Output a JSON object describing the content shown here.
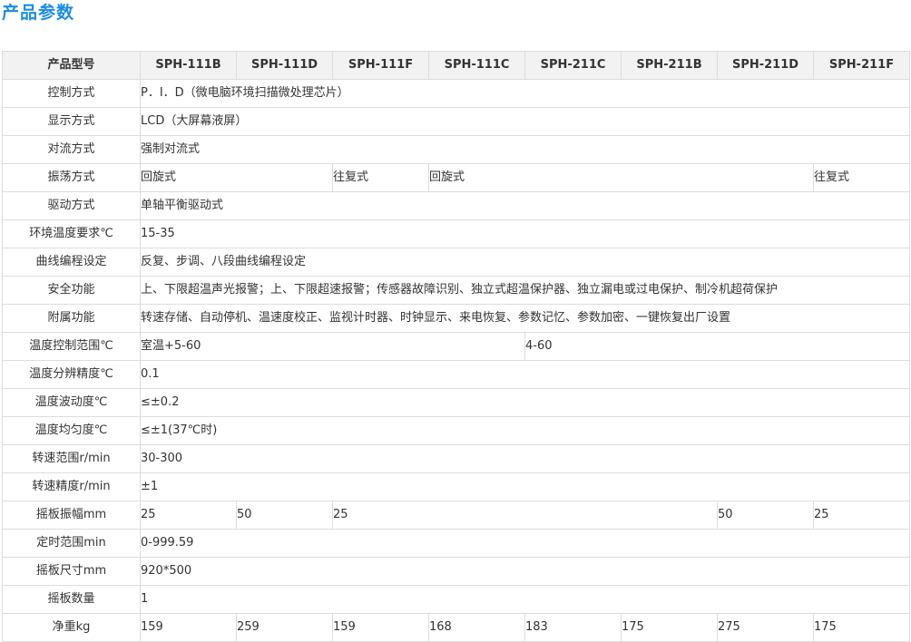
{
  "title": "产品参数",
  "header": [
    "产品型号",
    "SPH-111B",
    "SPH-111D",
    "SPH-111F",
    "SPH-111C",
    "SPH-211C",
    "SPH-211B",
    "SPH-211D",
    "SPH-211F"
  ],
  "rows": [
    {
      "label": "控制方式",
      "cells": [
        {
          "text": "P．I．D（微电脑环境扫描微处理芯片）",
          "span": 8
        }
      ]
    },
    {
      "label": "显示方式",
      "cells": [
        {
          "text": "LCD（大屏幕液屏）",
          "span": 8
        }
      ]
    },
    {
      "label": "对流方式",
      "cells": [
        {
          "text": "强制对流式",
          "span": 8
        }
      ]
    },
    {
      "label": "振荡方式",
      "cells": [
        {
          "text": "回旋式",
          "span": 2
        },
        {
          "text": "往复式",
          "span": 1
        },
        {
          "text": "回旋式",
          "span": 4
        },
        {
          "text": "往复式",
          "span": 1
        }
      ]
    },
    {
      "label": "驱动方式",
      "cells": [
        {
          "text": "单轴平衡驱动式",
          "span": 8
        }
      ]
    },
    {
      "label": "环境温度要求℃",
      "cells": [
        {
          "text": "15-35",
          "span": 8
        }
      ]
    },
    {
      "label": "曲线编程设定",
      "cells": [
        {
          "text": "反复、步调、八段曲线编程设定",
          "span": 8
        }
      ]
    },
    {
      "label": "安全功能",
      "cells": [
        {
          "text": "上、下限超温声光报警；上、下限超速报警；传感器故障识别、独立式超温保护器、独立漏电或过电保护、制冷机超荷保护",
          "span": 8
        }
      ]
    },
    {
      "label": "附属功能",
      "cells": [
        {
          "text": "转速存储、自动停机、温速度校正、监视计时器、时钟显示、来电恢复、参数记忆、参数加密、一键恢复出厂设置",
          "span": 8
        }
      ]
    },
    {
      "label": "温度控制范围℃",
      "cells": [
        {
          "text": "室温+5-60",
          "span": 4
        },
        {
          "text": "4-60",
          "span": 4
        }
      ]
    },
    {
      "label": "温度分辨精度℃",
      "cells": [
        {
          "text": "0.1",
          "span": 8
        }
      ]
    },
    {
      "label": "温度波动度℃",
      "cells": [
        {
          "text": "≤±0.2",
          "span": 8
        }
      ]
    },
    {
      "label": "温度均匀度℃",
      "cells": [
        {
          "text": "≤±1(37℃时)",
          "span": 8
        }
      ]
    },
    {
      "label": "转速范围r/min",
      "cells": [
        {
          "text": "30-300",
          "span": 8
        }
      ]
    },
    {
      "label": "转速精度r/min",
      "cells": [
        {
          "text": "±1",
          "span": 8
        }
      ]
    },
    {
      "label": "摇板振幅mm",
      "cells": [
        {
          "text": "25",
          "span": 1
        },
        {
          "text": "50",
          "span": 1
        },
        {
          "text": "25",
          "span": 4
        },
        {
          "text": "50",
          "span": 1
        },
        {
          "text": "25",
          "span": 1
        }
      ]
    },
    {
      "label": "定时范围min",
      "cells": [
        {
          "text": "0-999.59",
          "span": 8
        }
      ]
    },
    {
      "label": "摇板尺寸mm",
      "cells": [
        {
          "text": "920*500",
          "span": 8
        }
      ]
    },
    {
      "label": "摇板数量",
      "cells": [
        {
          "text": "1",
          "span": 8
        }
      ]
    },
    {
      "label": "净重kg",
      "cells": [
        {
          "text": "159",
          "span": 1
        },
        {
          "text": "259",
          "span": 1
        },
        {
          "text": "159",
          "span": 1
        },
        {
          "text": "168",
          "span": 1
        },
        {
          "text": "183",
          "span": 1
        },
        {
          "text": "175",
          "span": 1
        },
        {
          "text": "275",
          "span": 1
        },
        {
          "text": "175",
          "span": 1
        }
      ]
    }
  ]
}
